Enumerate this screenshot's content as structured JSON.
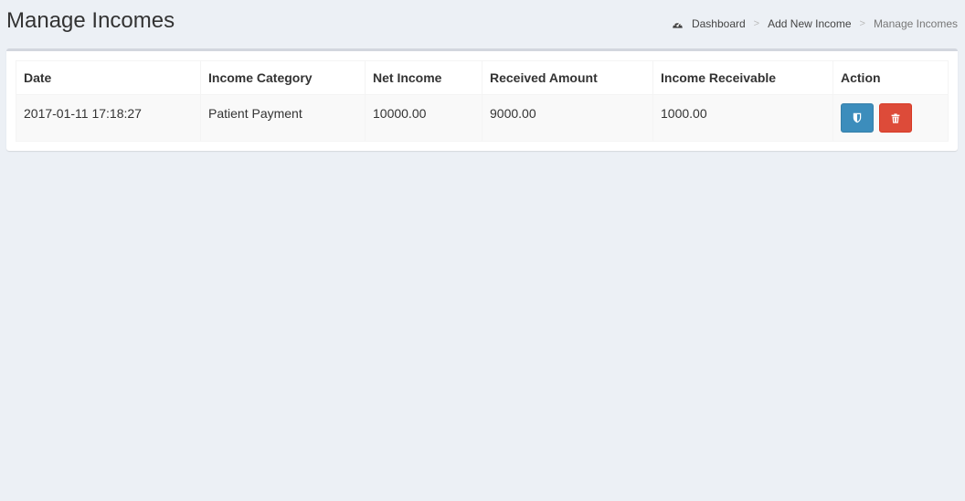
{
  "page": {
    "title": "Manage Incomes"
  },
  "breadcrumb": {
    "items": [
      {
        "label": "Dashboard",
        "icon": "dashboard-icon"
      },
      {
        "label": "Add New Income"
      },
      {
        "label": "Manage Incomes",
        "active": true
      }
    ],
    "separator": ">"
  },
  "table": {
    "columns": [
      "Date",
      "Income Category",
      "Net Income",
      "Received Amount",
      "Income Receivable",
      "Action"
    ],
    "rows": [
      {
        "date": "2017-01-11 17:18:27",
        "category": "Patient Payment",
        "net_income": "10000.00",
        "received_amount": "9000.00",
        "income_receivable": "1000.00",
        "actions": [
          {
            "name": "edit",
            "icon": "shield-icon",
            "color": "#3c8dbc"
          },
          {
            "name": "delete",
            "icon": "trash-icon",
            "color": "#dd4b39"
          }
        ]
      }
    ]
  },
  "colors": {
    "background": "#ecf0f5",
    "box_top_border": "#d2d6de",
    "primary": "#3c8dbc",
    "danger": "#dd4b39"
  }
}
